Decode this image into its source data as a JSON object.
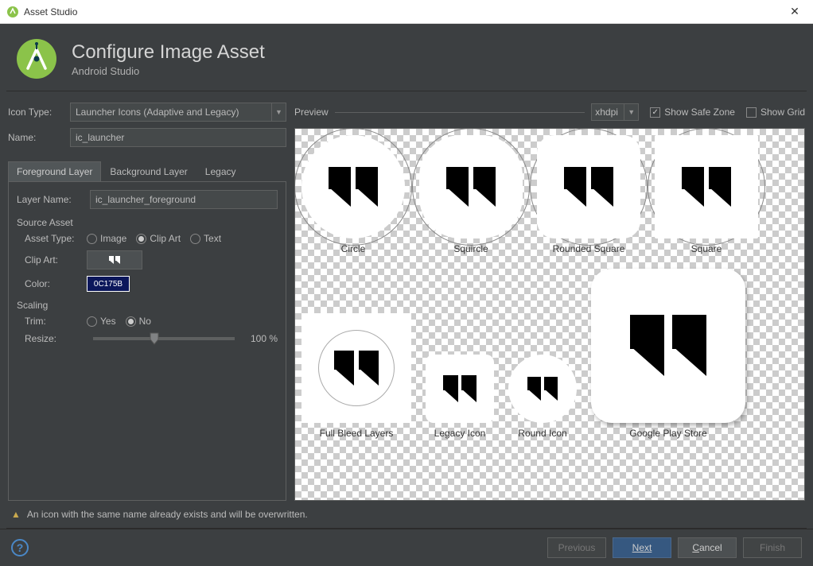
{
  "titlebar": {
    "title": "Asset Studio"
  },
  "header": {
    "title": "Configure Image Asset",
    "subtitle": "Android Studio"
  },
  "form": {
    "icon_type_label": "Icon Type:",
    "icon_type_value": "Launcher Icons (Adaptive and Legacy)",
    "name_label": "Name:",
    "name_value": "ic_launcher"
  },
  "tabs": {
    "foreground": "Foreground Layer",
    "background": "Background Layer",
    "legacy": "Legacy"
  },
  "layer": {
    "layer_name_label": "Layer Name:",
    "layer_name_value": "ic_launcher_foreground",
    "source_asset_label": "Source Asset",
    "asset_type_label": "Asset Type:",
    "asset_type_image": "Image",
    "asset_type_clipart": "Clip Art",
    "asset_type_text": "Text",
    "clipart_label": "Clip Art:",
    "color_label": "Color:",
    "color_value": "0C175B",
    "scaling_label": "Scaling",
    "trim_label": "Trim:",
    "trim_yes": "Yes",
    "trim_no": "No",
    "resize_label": "Resize:",
    "resize_value": "100 %"
  },
  "preview": {
    "label": "Preview",
    "dpi": "xhdpi",
    "safe_zone": "Show Safe Zone",
    "show_grid": "Show Grid",
    "captions": {
      "circle": "Circle",
      "squircle": "Squircle",
      "rounded": "Rounded Square",
      "square": "Square",
      "full": "Full Bleed Layers",
      "legacy": "Legacy Icon",
      "round": "Round Icon",
      "store": "Google Play Store"
    }
  },
  "warning": "An icon with the same name already exists and will be overwritten.",
  "buttons": {
    "previous": "Previous",
    "next": "Next",
    "cancel": "Cancel",
    "finish": "Finish"
  }
}
